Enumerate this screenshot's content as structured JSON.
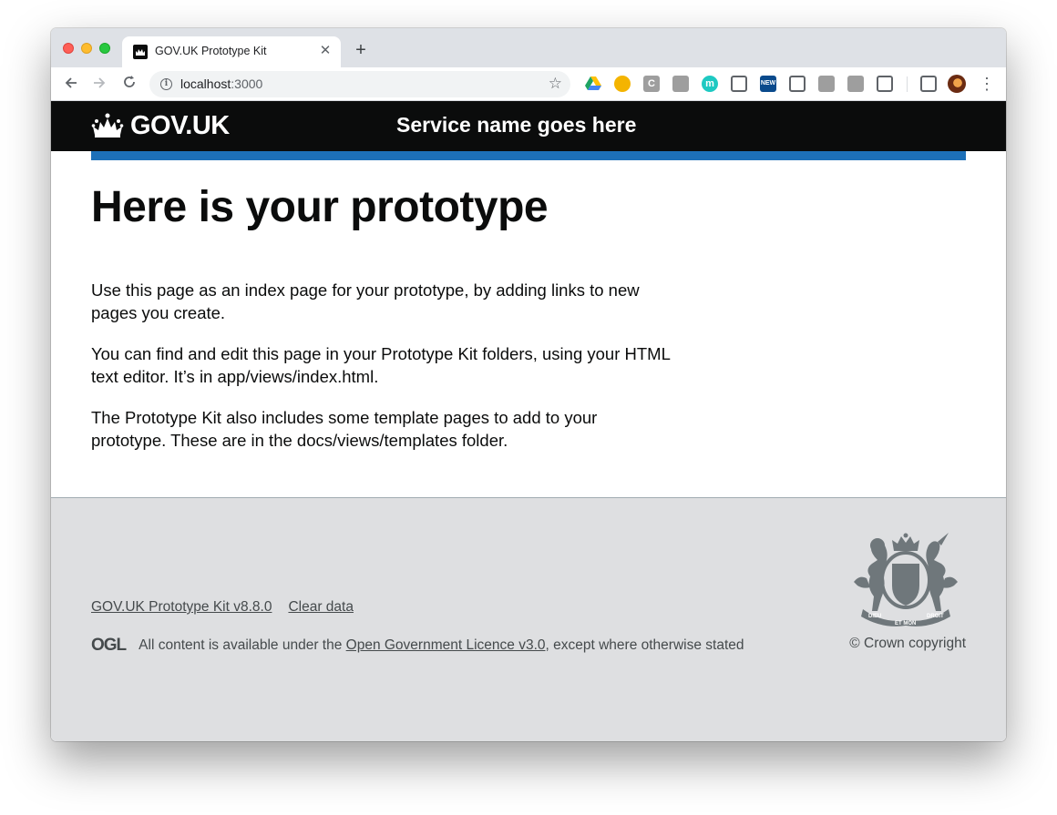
{
  "browser": {
    "tab": {
      "title": "GOV.UK Prototype Kit"
    },
    "address_bar": {
      "host": "localhost",
      "port": ":3000"
    },
    "extensions": [
      {
        "name": "google-drive-icon",
        "color": "#1fa463"
      },
      {
        "name": "chrome-ext-circle-icon",
        "color": "#f4b400"
      },
      {
        "name": "c-ext-icon",
        "color": "#9e9e9e",
        "glyph": "C"
      },
      {
        "name": "trello-icon",
        "color": "#9e9e9e"
      },
      {
        "name": "m-ext-icon",
        "color": "#1ec9c2",
        "glyph": "m"
      },
      {
        "name": "easel-icon",
        "color": "#5f6368"
      },
      {
        "name": "new-badge-icon",
        "color": "#0a4a8c",
        "glyph": "NEW"
      },
      {
        "name": "keep-icon",
        "color": "#5f6368"
      },
      {
        "name": "grid-icon",
        "color": "#9e9e9e"
      },
      {
        "name": "screen-icon",
        "color": "#9e9e9e"
      },
      {
        "name": "cast-icon",
        "color": "#5f6368"
      },
      {
        "name": "cast-icon",
        "color": "#5f6368"
      }
    ]
  },
  "header": {
    "logo_text": "GOV.UK",
    "service_name": "Service name goes here"
  },
  "main": {
    "heading": "Here is your prototype",
    "paragraphs": [
      "Use this page as an index page for your prototype, by adding links to new pages you create.",
      "You can find and edit this page in your Prototype Kit folders, using your HTML text editor. It’s in app/views/index.html.",
      "The Prototype Kit also includes some template pages to add to your prototype. These are in the docs/views/templates folder."
    ]
  },
  "footer": {
    "links": [
      "GOV.UK Prototype Kit v8.8.0",
      "Clear data"
    ],
    "ogl_logo": "OGL",
    "licence_prefix": "All content is available under the ",
    "licence_link": "Open Government Licence v3.0",
    "licence_suffix": ", except where otherwise stated",
    "copyright": "© Crown copyright",
    "crest_text": [
      "DIEU",
      "ET MON",
      "DROIT"
    ]
  },
  "colors": {
    "header_bg": "#0b0c0c",
    "brand_blue": "#1d70b8",
    "footer_bg": "#dedfe1",
    "footer_text": "#454a4c"
  }
}
